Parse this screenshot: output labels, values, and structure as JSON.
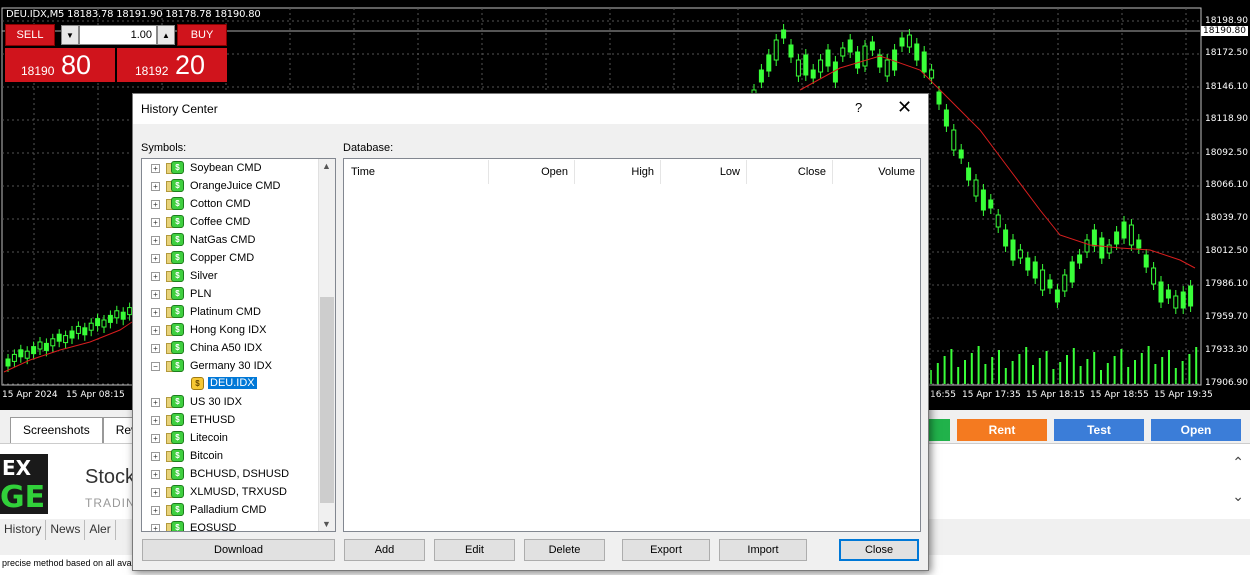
{
  "chart": {
    "header": "DEU.IDX,M5  18183.78 18191.90 18178.78 18190.80",
    "current_price": "18190.80",
    "price_labels": [
      "18198.90",
      "18172.50",
      "18146.10",
      "18118.90",
      "18092.50",
      "18066.10",
      "18039.70",
      "18012.50",
      "17986.10",
      "17959.70",
      "17933.30",
      "17906.90"
    ],
    "time_labels": [
      "15 Apr 2024",
      "15 Apr 08:15",
      "16:55",
      "15 Apr 17:35",
      "15 Apr 18:15",
      "15 Apr 18:55",
      "15 Apr 19:35"
    ]
  },
  "oneclick": {
    "sell_label": "SELL",
    "buy_label": "BUY",
    "lot": "1.00",
    "minus_icon": "▼",
    "plus_icon": "▲",
    "sell_small": "18190",
    "sell_big": "80",
    "buy_small": "18192",
    "buy_big": "20"
  },
  "bottom": {
    "tabs": [
      "Screenshots",
      "Rev"
    ],
    "actions": [
      {
        "label": "",
        "color": "#21b24b"
      },
      {
        "label": "Rent",
        "color": "#f47a20"
      },
      {
        "label": "Test",
        "color": "#3b7dd8"
      },
      {
        "label": "Open",
        "color": "#3b7dd8"
      }
    ],
    "logo_top": "EX",
    "logo_bottom": "GE",
    "title": "Stock",
    "subtitle": "TRADIN",
    "lower_tabs": [
      "History",
      "News",
      "Aler"
    ],
    "status": "precise method based on all ava"
  },
  "dialog": {
    "title": "History Center",
    "help": "?",
    "close": "✕",
    "symbols_label": "Symbols:",
    "database_label": "Database:",
    "tree": [
      {
        "label": "Soybean CMD",
        "type": "folder",
        "expander": "+"
      },
      {
        "label": "OrangeJuice CMD",
        "type": "folder",
        "expander": "+"
      },
      {
        "label": "Cotton CMD",
        "type": "folder",
        "expander": "+"
      },
      {
        "label": "Coffee CMD",
        "type": "folder",
        "expander": "+"
      },
      {
        "label": "NatGas CMD",
        "type": "folder",
        "expander": "+"
      },
      {
        "label": "Copper CMD",
        "type": "folder",
        "expander": "+"
      },
      {
        "label": "Silver",
        "type": "folder",
        "expander": "+"
      },
      {
        "label": "PLN",
        "type": "folder",
        "expander": "+"
      },
      {
        "label": "Platinum CMD",
        "type": "folder",
        "expander": "+"
      },
      {
        "label": "Hong Kong IDX",
        "type": "folder",
        "expander": "+"
      },
      {
        "label": "China A50 IDX",
        "type": "folder",
        "expander": "+"
      },
      {
        "label": "Germany 30 IDX",
        "type": "folder",
        "expander": "−"
      },
      {
        "label": "DEU.IDX",
        "type": "leaf",
        "selected": true
      },
      {
        "label": "US 30 IDX",
        "type": "folder",
        "expander": "+"
      },
      {
        "label": "ETHUSD",
        "type": "folder",
        "expander": "+"
      },
      {
        "label": "Litecoin",
        "type": "folder",
        "expander": "+"
      },
      {
        "label": "Bitcoin",
        "type": "folder",
        "expander": "+"
      },
      {
        "label": "BCHUSD, DSHUSD",
        "type": "folder",
        "expander": "+"
      },
      {
        "label": "XLMUSD, TRXUSD",
        "type": "folder",
        "expander": "+"
      },
      {
        "label": "Palladium CMD",
        "type": "folder",
        "expander": "+"
      },
      {
        "label": "EOSUSD",
        "type": "folder",
        "expander": "+"
      }
    ],
    "columns": [
      "Time",
      "Open",
      "High",
      "Low",
      "Close",
      "Volume"
    ],
    "buttons": {
      "download": "Download",
      "add": "Add",
      "edit": "Edit",
      "delete": "Delete",
      "export": "Export",
      "import": "Import",
      "close": "Close"
    }
  }
}
